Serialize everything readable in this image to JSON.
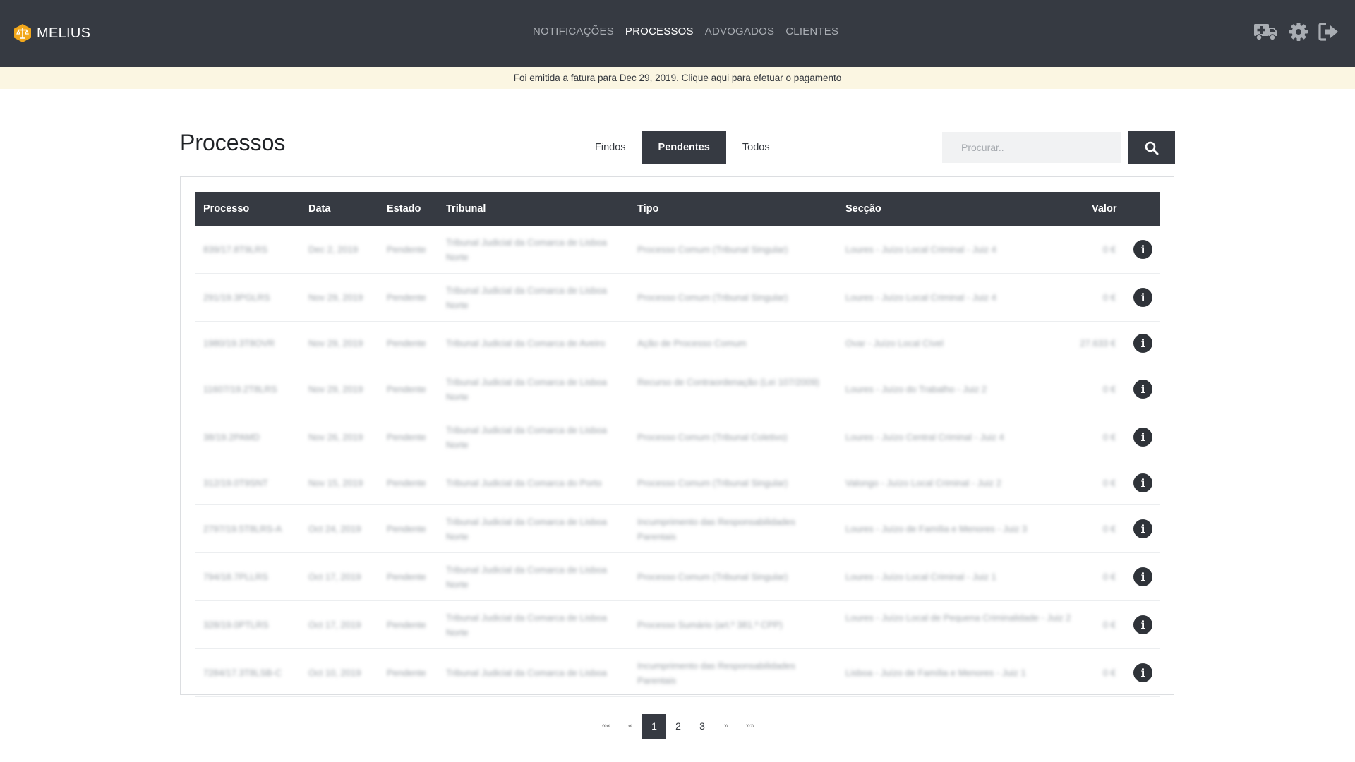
{
  "app": {
    "name": "MELIUS"
  },
  "nav": [
    {
      "label": "NOTIFICAÇÕES",
      "active": false
    },
    {
      "label": "PROCESSOS",
      "active": true
    },
    {
      "label": "ADVOGADOS",
      "active": false
    },
    {
      "label": "CLIENTES",
      "active": false
    }
  ],
  "header_icons": [
    "ambulance-icon",
    "gear-icon",
    "sign-out-icon"
  ],
  "banner": {
    "text": "Foi emitida a fatura para Dec 29, 2019. Clique aqui para efetuar o pagamento"
  },
  "page": {
    "title": "Processos"
  },
  "filters": [
    {
      "label": "Findos",
      "active": false
    },
    {
      "label": "Pendentes",
      "active": true
    },
    {
      "label": "Todos",
      "active": false
    }
  ],
  "search": {
    "placeholder": "Procurar.."
  },
  "table": {
    "headers": {
      "processo": "Processo",
      "data": "Data",
      "estado": "Estado",
      "tribunal": "Tribunal",
      "tipo": "Tipo",
      "seccao": "Secção",
      "valor": "Valor"
    },
    "rows": [
      {
        "processo": "839/17.8T9LRS",
        "data": "Dec 2, 2019",
        "estado": "Pendente",
        "tribunal": "Tribunal Judicial da Comarca de Lisboa Norte",
        "tipo": "Processo Comum (Tribunal Singular)",
        "seccao": "Loures - Juízo Local Criminal - Juiz 4",
        "valor": "0 €"
      },
      {
        "processo": "291/19.3PGLRS",
        "data": "Nov 29, 2019",
        "estado": "Pendente",
        "tribunal": "Tribunal Judicial da Comarca de Lisboa Norte",
        "tipo": "Processo Comum (Tribunal Singular)",
        "seccao": "Loures - Juízo Local Criminal - Juiz 4",
        "valor": "0 €"
      },
      {
        "processo": "1980/19.3T8OVR",
        "data": "Nov 29, 2019",
        "estado": "Pendente",
        "tribunal": "Tribunal Judicial da Comarca de Aveiro",
        "tipo": "Ação de Processo Comum",
        "seccao": "Ovar - Juízo Local Cível",
        "valor": "27.633 €"
      },
      {
        "processo": "11607/19.2T8LRS",
        "data": "Nov 29, 2019",
        "estado": "Pendente",
        "tribunal": "Tribunal Judicial da Comarca de Lisboa Norte",
        "tipo": "Recurso de Contraordenação (Lei 107/2009)",
        "seccao": "Loures - Juízo do Trabalho - Juiz 2",
        "valor": "0 €"
      },
      {
        "processo": "38/19.2PAMD",
        "data": "Nov 26, 2019",
        "estado": "Pendente",
        "tribunal": "Tribunal Judicial da Comarca de Lisboa Norte",
        "tipo": "Processo Comum (Tribunal Coletivo)",
        "seccao": "Loures - Juízo Central Criminal - Juiz 4",
        "valor": "0 €"
      },
      {
        "processo": "312/19.0T9SNT",
        "data": "Nov 15, 2019",
        "estado": "Pendente",
        "tribunal": "Tribunal Judicial da Comarca do Porto",
        "tipo": "Processo Comum (Tribunal Singular)",
        "seccao": "Valongo - Juízo Local Criminal - Juiz 2",
        "valor": "0 €"
      },
      {
        "processo": "2797/19.5T8LRS-A",
        "data": "Oct 24, 2019",
        "estado": "Pendente",
        "tribunal": "Tribunal Judicial da Comarca de Lisboa Norte",
        "tipo": "Incumprimento das Responsabilidades Parentais",
        "seccao": "Loures - Juízo de Família e Menores - Juiz 3",
        "valor": "0 €"
      },
      {
        "processo": "794/18.7PLLRS",
        "data": "Oct 17, 2019",
        "estado": "Pendente",
        "tribunal": "Tribunal Judicial da Comarca de Lisboa Norte",
        "tipo": "Processo Comum (Tribunal Singular)",
        "seccao": "Loures - Juízo Local Criminal - Juiz 1",
        "valor": "0 €"
      },
      {
        "processo": "328/19.0PTLRS",
        "data": "Oct 17, 2019",
        "estado": "Pendente",
        "tribunal": "Tribunal Judicial da Comarca de Lisboa Norte",
        "tipo": "Processo Sumário (art.º 381.º CPP)",
        "seccao": "Loures - Juízo Local de Pequena Criminalidade - Juiz 2",
        "valor": "0 €"
      },
      {
        "processo": "7284/17.3T8LSB-C",
        "data": "Oct 10, 2019",
        "estado": "Pendente",
        "tribunal": "Tribunal Judicial da Comarca de Lisboa",
        "tipo": "Incumprimento das Responsabilidades Parentais",
        "seccao": "Lisboa - Juízo de Família e Menores - Juiz 1",
        "valor": "0 €"
      }
    ]
  },
  "pagination": {
    "first": "««",
    "prev": "«",
    "pages": [
      "1",
      "2",
      "3"
    ],
    "current": "1",
    "next": "»",
    "last": "»»"
  }
}
